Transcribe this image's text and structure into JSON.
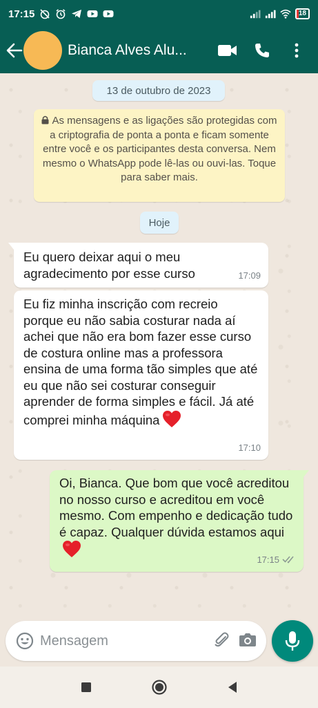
{
  "status": {
    "time": "17:15",
    "battery": "18",
    "battery_level": 0.18,
    "left_icons": [
      "no-alarm-icon",
      "alarm-icon",
      "telegram-icon",
      "youtube-icon",
      "youtube-icon"
    ],
    "right_icons": [
      "signal-icon",
      "signal-icon",
      "wifi-icon",
      "battery-icon"
    ]
  },
  "header": {
    "contact_name": "Bianca Alves Alu...",
    "avatar_color": "#f7b955",
    "bar_color": "#075e54"
  },
  "chat": {
    "date_label": "13 de outubro de 2023",
    "encryption_notice": "As mensagens e as ligações são protegidas com a criptografia de ponta a ponta e ficam somente entre você e os participantes desta conversa. Nem mesmo o WhatsApp pode lê-las ou ouvi-las. Toque para saber mais.",
    "today_label": "Hoje",
    "messages": [
      {
        "direction": "in",
        "text": "Eu quero deixar aqui o meu agradecimento por esse curso",
        "time": "17:09"
      },
      {
        "direction": "in",
        "text": "Eu fiz minha inscrição com recreio porque eu não sabia costurar nada aí achei que não era bom fazer esse curso de costura online mas a professora ensina de uma forma tão simples que até eu que não sei costurar conseguir aprender de forma simples e fácil. Já até comprei minha máquina",
        "emoji": "red-heart",
        "time": "17:10"
      },
      {
        "direction": "out",
        "text": "Oi, Bianca.  Que bom que você acreditou no nosso curso e acreditou em você mesmo. Com empenho e dedicação tudo é capaz. Qualquer dúvida estamos aqui",
        "emoji": "red-heart",
        "time": "17:15",
        "status": "read"
      }
    ]
  },
  "composer": {
    "placeholder": "Mensagem",
    "accent": "#00897b"
  },
  "nav": [
    "recents",
    "home",
    "back"
  ]
}
